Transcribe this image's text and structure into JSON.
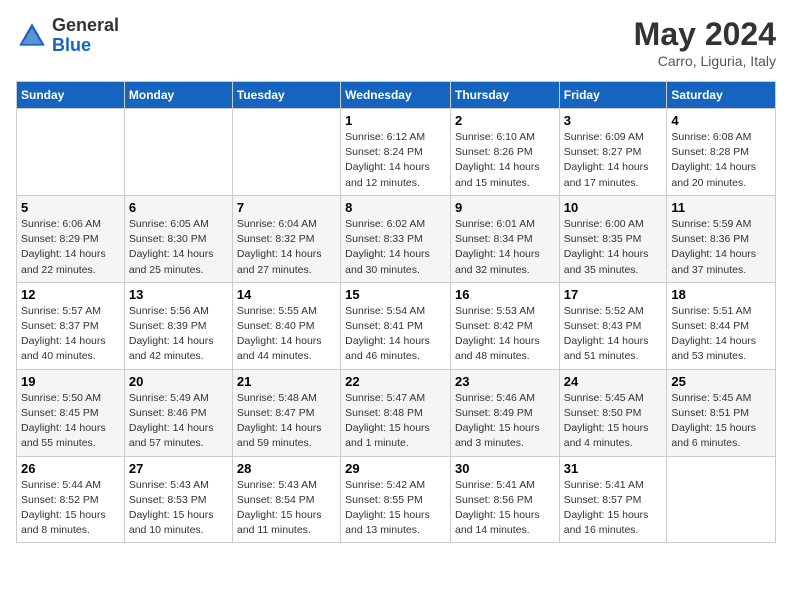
{
  "header": {
    "logo_general": "General",
    "logo_blue": "Blue",
    "month_title": "May 2024",
    "subtitle": "Carro, Liguria, Italy"
  },
  "days_of_week": [
    "Sunday",
    "Monday",
    "Tuesday",
    "Wednesday",
    "Thursday",
    "Friday",
    "Saturday"
  ],
  "weeks": [
    [
      {
        "day": "",
        "info": ""
      },
      {
        "day": "",
        "info": ""
      },
      {
        "day": "",
        "info": ""
      },
      {
        "day": "1",
        "info": "Sunrise: 6:12 AM\nSunset: 8:24 PM\nDaylight: 14 hours and 12 minutes."
      },
      {
        "day": "2",
        "info": "Sunrise: 6:10 AM\nSunset: 8:26 PM\nDaylight: 14 hours and 15 minutes."
      },
      {
        "day": "3",
        "info": "Sunrise: 6:09 AM\nSunset: 8:27 PM\nDaylight: 14 hours and 17 minutes."
      },
      {
        "day": "4",
        "info": "Sunrise: 6:08 AM\nSunset: 8:28 PM\nDaylight: 14 hours and 20 minutes."
      }
    ],
    [
      {
        "day": "5",
        "info": "Sunrise: 6:06 AM\nSunset: 8:29 PM\nDaylight: 14 hours and 22 minutes."
      },
      {
        "day": "6",
        "info": "Sunrise: 6:05 AM\nSunset: 8:30 PM\nDaylight: 14 hours and 25 minutes."
      },
      {
        "day": "7",
        "info": "Sunrise: 6:04 AM\nSunset: 8:32 PM\nDaylight: 14 hours and 27 minutes."
      },
      {
        "day": "8",
        "info": "Sunrise: 6:02 AM\nSunset: 8:33 PM\nDaylight: 14 hours and 30 minutes."
      },
      {
        "day": "9",
        "info": "Sunrise: 6:01 AM\nSunset: 8:34 PM\nDaylight: 14 hours and 32 minutes."
      },
      {
        "day": "10",
        "info": "Sunrise: 6:00 AM\nSunset: 8:35 PM\nDaylight: 14 hours and 35 minutes."
      },
      {
        "day": "11",
        "info": "Sunrise: 5:59 AM\nSunset: 8:36 PM\nDaylight: 14 hours and 37 minutes."
      }
    ],
    [
      {
        "day": "12",
        "info": "Sunrise: 5:57 AM\nSunset: 8:37 PM\nDaylight: 14 hours and 40 minutes."
      },
      {
        "day": "13",
        "info": "Sunrise: 5:56 AM\nSunset: 8:39 PM\nDaylight: 14 hours and 42 minutes."
      },
      {
        "day": "14",
        "info": "Sunrise: 5:55 AM\nSunset: 8:40 PM\nDaylight: 14 hours and 44 minutes."
      },
      {
        "day": "15",
        "info": "Sunrise: 5:54 AM\nSunset: 8:41 PM\nDaylight: 14 hours and 46 minutes."
      },
      {
        "day": "16",
        "info": "Sunrise: 5:53 AM\nSunset: 8:42 PM\nDaylight: 14 hours and 48 minutes."
      },
      {
        "day": "17",
        "info": "Sunrise: 5:52 AM\nSunset: 8:43 PM\nDaylight: 14 hours and 51 minutes."
      },
      {
        "day": "18",
        "info": "Sunrise: 5:51 AM\nSunset: 8:44 PM\nDaylight: 14 hours and 53 minutes."
      }
    ],
    [
      {
        "day": "19",
        "info": "Sunrise: 5:50 AM\nSunset: 8:45 PM\nDaylight: 14 hours and 55 minutes."
      },
      {
        "day": "20",
        "info": "Sunrise: 5:49 AM\nSunset: 8:46 PM\nDaylight: 14 hours and 57 minutes."
      },
      {
        "day": "21",
        "info": "Sunrise: 5:48 AM\nSunset: 8:47 PM\nDaylight: 14 hours and 59 minutes."
      },
      {
        "day": "22",
        "info": "Sunrise: 5:47 AM\nSunset: 8:48 PM\nDaylight: 15 hours and 1 minute."
      },
      {
        "day": "23",
        "info": "Sunrise: 5:46 AM\nSunset: 8:49 PM\nDaylight: 15 hours and 3 minutes."
      },
      {
        "day": "24",
        "info": "Sunrise: 5:45 AM\nSunset: 8:50 PM\nDaylight: 15 hours and 4 minutes."
      },
      {
        "day": "25",
        "info": "Sunrise: 5:45 AM\nSunset: 8:51 PM\nDaylight: 15 hours and 6 minutes."
      }
    ],
    [
      {
        "day": "26",
        "info": "Sunrise: 5:44 AM\nSunset: 8:52 PM\nDaylight: 15 hours and 8 minutes."
      },
      {
        "day": "27",
        "info": "Sunrise: 5:43 AM\nSunset: 8:53 PM\nDaylight: 15 hours and 10 minutes."
      },
      {
        "day": "28",
        "info": "Sunrise: 5:43 AM\nSunset: 8:54 PM\nDaylight: 15 hours and 11 minutes."
      },
      {
        "day": "29",
        "info": "Sunrise: 5:42 AM\nSunset: 8:55 PM\nDaylight: 15 hours and 13 minutes."
      },
      {
        "day": "30",
        "info": "Sunrise: 5:41 AM\nSunset: 8:56 PM\nDaylight: 15 hours and 14 minutes."
      },
      {
        "day": "31",
        "info": "Sunrise: 5:41 AM\nSunset: 8:57 PM\nDaylight: 15 hours and 16 minutes."
      },
      {
        "day": "",
        "info": ""
      }
    ]
  ]
}
